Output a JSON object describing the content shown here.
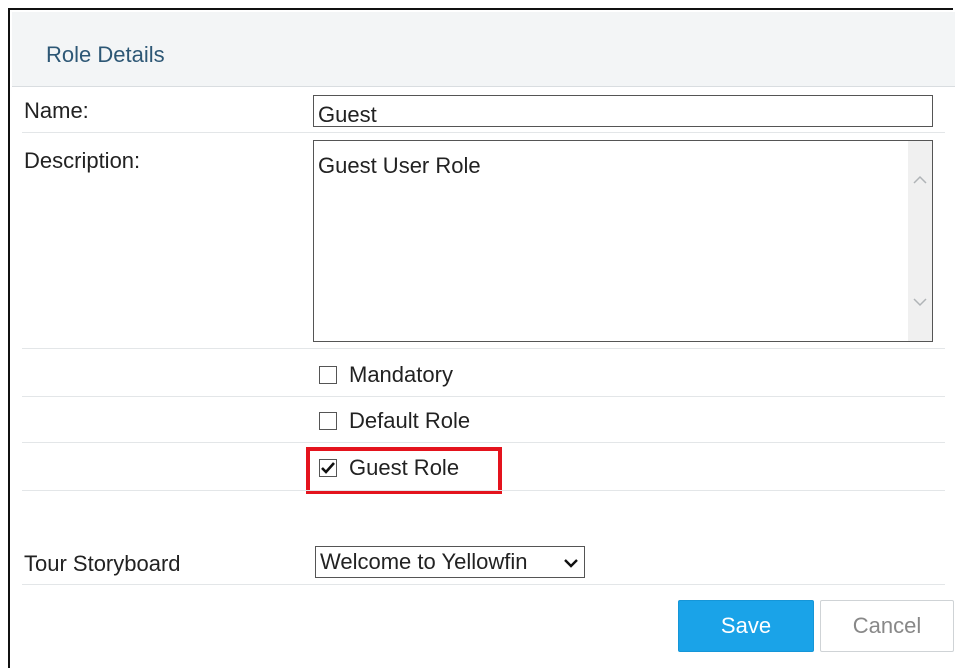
{
  "panel": {
    "title": "Role Details"
  },
  "fields": {
    "name_label": "Name:",
    "name_value": "Guest",
    "description_label": "Description:",
    "description_value": "Guest User Role",
    "tour_label": "Tour Storyboard",
    "tour_selected": "Welcome to Yellowfin"
  },
  "checkboxes": [
    {
      "label": "Mandatory",
      "checked": false
    },
    {
      "label": "Default Role",
      "checked": false
    },
    {
      "label": "Guest Role",
      "checked": true
    }
  ],
  "buttons": {
    "save": "Save",
    "cancel": "Cancel"
  },
  "colors": {
    "accent": "#1aa3e8",
    "highlight": "#e4131d",
    "title": "#2d5775"
  }
}
